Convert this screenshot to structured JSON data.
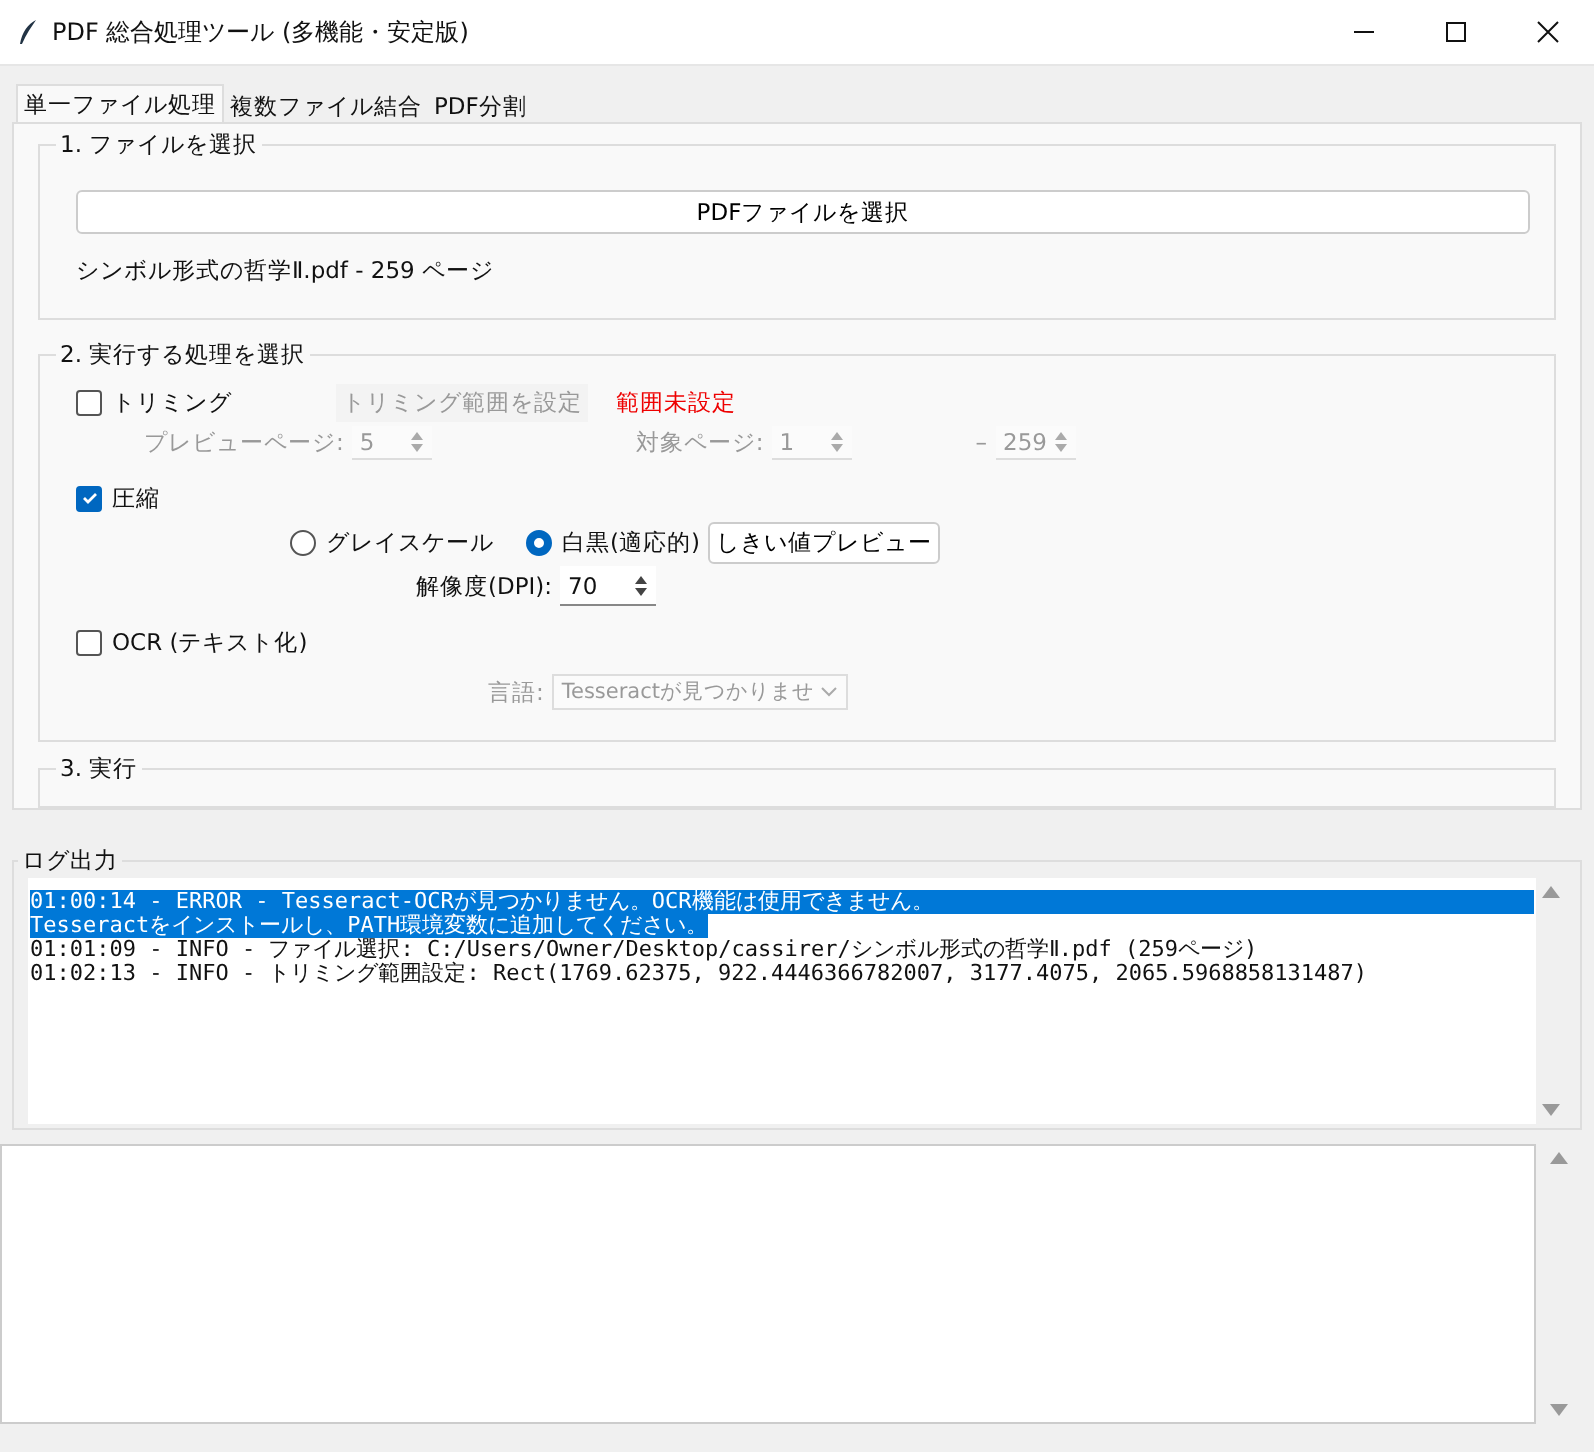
{
  "window": {
    "title": "PDF 総合処理ツール (多機能・安定版)"
  },
  "tabs": [
    {
      "label": "単一ファイル処理",
      "selected": true
    },
    {
      "label": "複数ファイル結合",
      "selected": false
    },
    {
      "label": "PDF分割",
      "selected": false
    }
  ],
  "file_section": {
    "title": "1. ファイルを選択",
    "button": "PDFファイルを選択",
    "file_info": "シンボル形式の哲学Ⅱ.pdf - 259 ページ"
  },
  "process_section": {
    "title": "2. 実行する処理を選択",
    "trim": {
      "label": "トリミング",
      "checked": false,
      "range_button": "トリミング範囲を設定",
      "range_status": "範囲未設定",
      "preview_label": "プレビューページ:",
      "preview_value": "5",
      "target_label": "対象ページ:",
      "target_from": "1",
      "separator": "–",
      "target_to": "259",
      "disabled": true
    },
    "compress": {
      "label": "圧縮",
      "checked": true,
      "modes": [
        {
          "label": "グレイスケール",
          "selected": false
        },
        {
          "label": "白黒(適応的)",
          "selected": true
        }
      ],
      "threshold_button": "しきい値プレビュー",
      "dpi_label": "解像度(DPI):",
      "dpi_value": "70"
    },
    "ocr": {
      "label": "OCR (テキスト化)",
      "checked": false,
      "language_label": "言語:",
      "language_value": "Tesseractが見つかりませ",
      "disabled": true
    }
  },
  "run_section": {
    "title": "3. 実行"
  },
  "log": {
    "title": "ログ出力",
    "lines": [
      {
        "text": "01:00:14 - ERROR - Tesseract-OCRが見つかりません。OCR機能は使用できません。",
        "selected": true
      },
      {
        "text": "Tesseractをインストールし、PATH環境変数に追加してください。",
        "selected": true
      },
      {
        "text": "01:01:09 - INFO - ファイル選択: C:/Users/Owner/Desktop/cassirer/シンボル形式の哲学Ⅱ.pdf (259ページ)",
        "selected": false
      },
      {
        "text": "01:02:13 - INFO - トリミング範囲設定: Rect(1769.62375, 922.4446366782007, 3177.4075, 2065.5968858131487)",
        "selected": false
      }
    ]
  }
}
